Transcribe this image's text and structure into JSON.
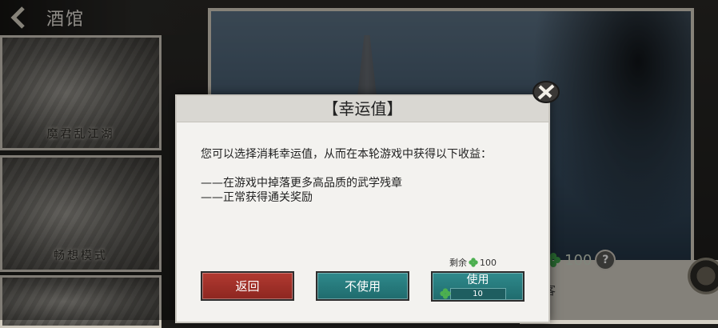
{
  "header": {
    "title": "酒馆"
  },
  "cards": [
    {
      "label": "魔君乱江湖"
    },
    {
      "label": "畅想模式"
    }
  ],
  "background": {
    "luck_value": "100",
    "side_text": "客"
  },
  "dialog": {
    "title": "【幸运值】",
    "description": "您可以选择消耗幸运值，从而在本轮游戏中获得以下收益：",
    "benefits": [
      "——在游戏中掉落更多高品质的武学残章",
      "——正常获得通关奖励"
    ],
    "remaining_label": "剩余",
    "remaining_value": "100",
    "buttons": {
      "return": "返回",
      "no_use": "不使用",
      "use": "使用",
      "use_cost": "10"
    }
  },
  "colors": {
    "return_button": "#b23a31",
    "teal_button": "#2f8a8c",
    "clover": "#4caf50"
  },
  "icons": [
    "back-arrow-icon",
    "close-icon",
    "clover-icon",
    "help-icon"
  ]
}
